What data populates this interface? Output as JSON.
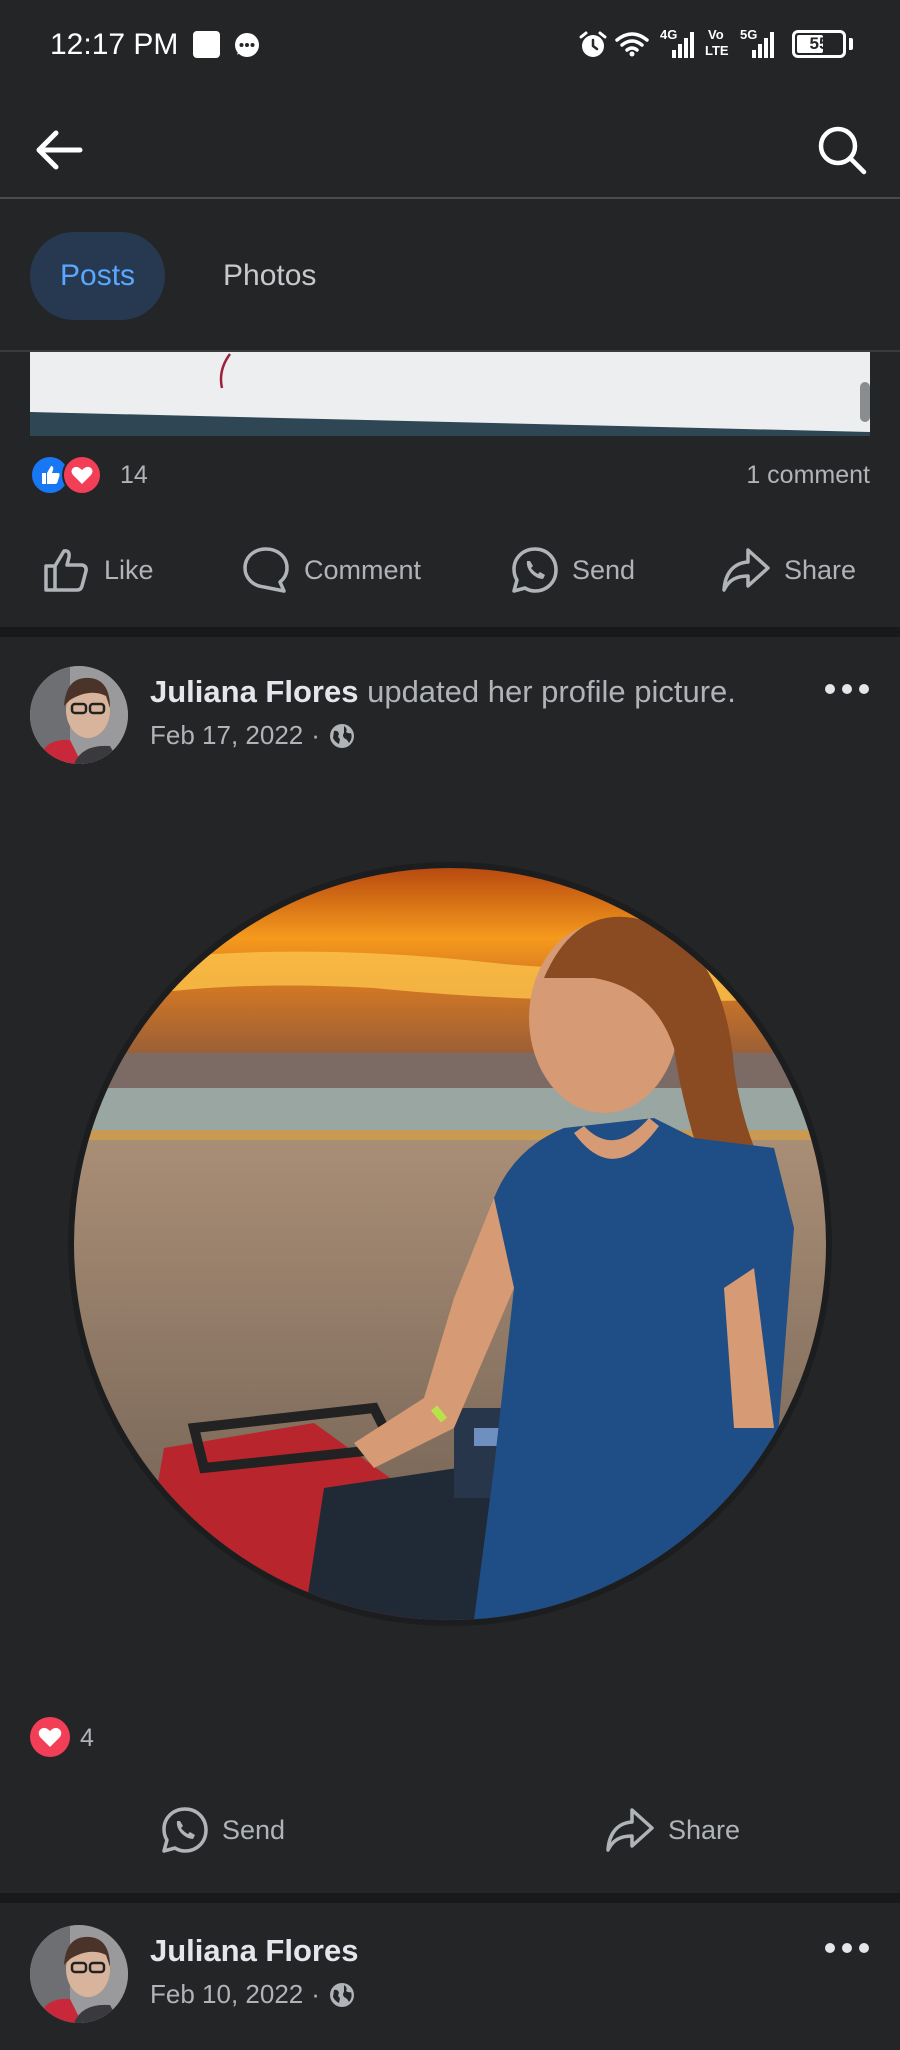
{
  "status_bar": {
    "time": "12:17 PM",
    "network_1": "4G",
    "network_2_top": "Vo",
    "network_2_bottom": "LTE",
    "network_3": "5G",
    "battery": "55"
  },
  "tabs": [
    {
      "label": "Posts",
      "active": true
    },
    {
      "label": "Photos",
      "active": false
    }
  ],
  "previous_post": {
    "reaction_count": "14",
    "comment_count": "1 comment",
    "actions": [
      "Like",
      "Comment",
      "Send",
      "Share"
    ]
  },
  "post_1": {
    "author": "Juliana Flores",
    "activity": " updated her profile picture.",
    "date": "Feb 17, 2022",
    "separator": "·",
    "reaction_count": "4",
    "actions": [
      "Send",
      "Share"
    ]
  },
  "post_2": {
    "author": "Juliana Flores",
    "date": "Feb 10, 2022",
    "separator": "·"
  },
  "colors": {
    "background": "#242526",
    "divider": "#18191a",
    "accent": "#5aa7ff",
    "like": "#1877f2",
    "love": "#f33e58"
  }
}
